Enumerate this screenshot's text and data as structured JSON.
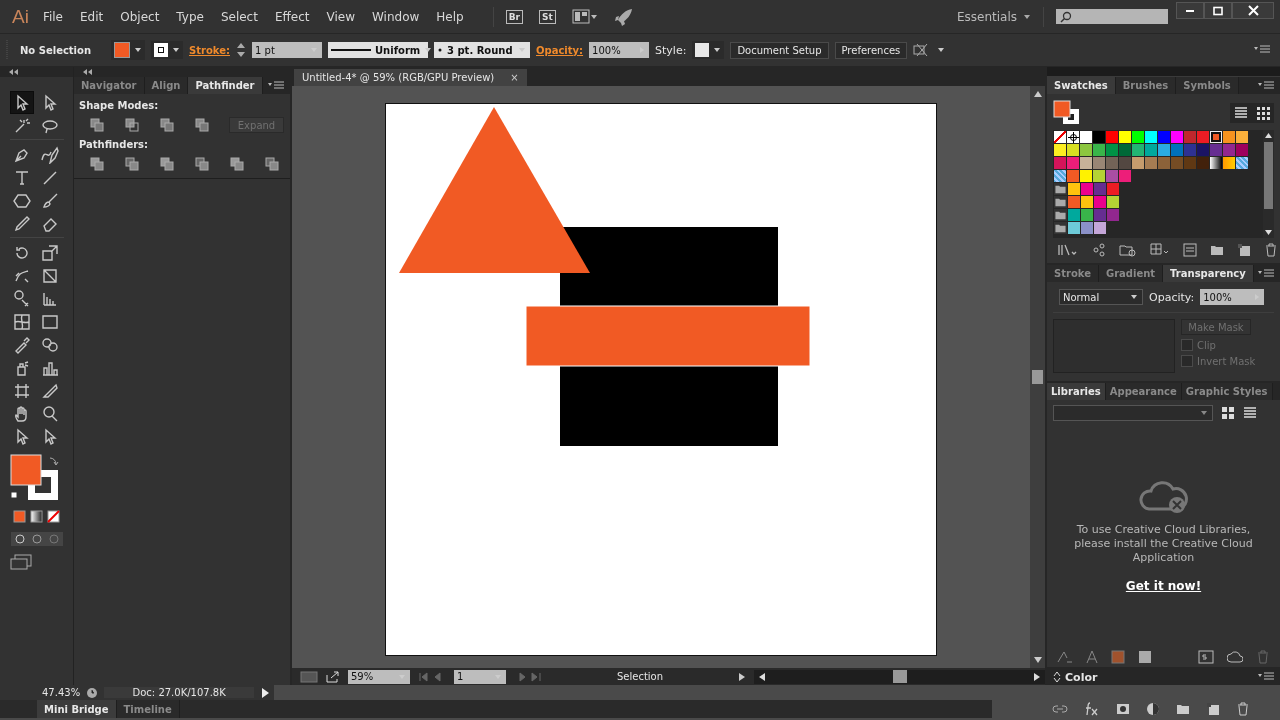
{
  "app": {
    "logo": "Ai",
    "menus": [
      "File",
      "Edit",
      "Object",
      "Type",
      "Select",
      "Effect",
      "View",
      "Window",
      "Help"
    ],
    "badges": [
      "Br",
      "St"
    ],
    "workspace": "Essentials"
  },
  "control_bar": {
    "selection": "No Selection",
    "stroke_label": "Stroke:",
    "stroke_weight": "1 pt",
    "profile": "Uniform",
    "brush": "3 pt. Round",
    "opacity_label": "Opacity:",
    "opacity": "100%",
    "style_label": "Style:",
    "buttons": [
      "Document Setup",
      "Preferences"
    ]
  },
  "tools": [
    {
      "selected": true
    },
    {
      "selected": false
    },
    {
      "selected": false
    },
    {
      "selected": false
    },
    {
      "selected": false
    },
    {
      "selected": false
    },
    {
      "selected": false
    },
    {
      "selected": false
    },
    {
      "selected": false
    },
    {
      "selected": false
    },
    {
      "selected": false
    },
    {
      "selected": false
    },
    {
      "selected": false
    },
    {
      "selected": false
    },
    {
      "selected": false
    },
    {
      "selected": false
    },
    {
      "selected": false
    },
    {
      "selected": false
    },
    {
      "selected": false
    },
    {
      "selected": false
    },
    {
      "selected": false
    },
    {
      "selected": false
    },
    {
      "selected": false
    },
    {
      "selected": false
    },
    {
      "selected": false
    },
    {
      "selected": false
    },
    {
      "selected": false
    },
    {
      "selected": false
    },
    {
      "selected": false
    },
    {
      "selected": false
    }
  ],
  "left_panel": {
    "tabs": [
      {
        "label": "Navigator",
        "selected": false
      },
      {
        "label": "Align",
        "selected": false
      },
      {
        "label": "Pathfinder",
        "selected": true
      }
    ],
    "shape_modes_label": "Shape Modes:",
    "expand": {
      "label": "Expand",
      "disabled": true
    },
    "pathfinders_label": "Pathfinders:"
  },
  "document": {
    "tab_title": "Untitled-4* @ 59% (RGB/GPU Preview)",
    "close": "×"
  },
  "status_bar": {
    "zoom": "59%",
    "page": "1",
    "tool": "Selection"
  },
  "swatches_panel": {
    "tabs": [
      {
        "label": "Swatches",
        "selected": true
      },
      {
        "label": "Brushes",
        "selected": false
      },
      {
        "label": "Symbols",
        "selected": false
      }
    ],
    "rows": [
      [
        {
          "kind": "none",
          "selected": false
        },
        {
          "kind": "registration",
          "selected": false
        },
        {
          "kind": "solid",
          "color": "#ffffff",
          "selected": false
        },
        {
          "kind": "solid",
          "color": "#000000",
          "selected": false
        },
        {
          "kind": "solid",
          "color": "#ff0000",
          "selected": false
        },
        {
          "kind": "solid",
          "color": "#ffff00",
          "selected": false
        },
        {
          "kind": "solid",
          "color": "#00ff00",
          "selected": false
        },
        {
          "kind": "solid",
          "color": "#00ffff",
          "selected": false
        },
        {
          "kind": "solid",
          "color": "#0000ff",
          "selected": false
        },
        {
          "kind": "solid",
          "color": "#ff00ff",
          "selected": false
        },
        {
          "kind": "solid",
          "color": "#c1272d",
          "selected": false
        },
        {
          "kind": "solid",
          "color": "#ed1c24",
          "selected": false
        },
        {
          "kind": "solid",
          "color": "#f15a24",
          "selected": true
        },
        {
          "kind": "solid",
          "color": "#f7931e",
          "selected": false
        },
        {
          "kind": "solid",
          "color": "#fbb03b",
          "selected": false
        }
      ],
      [
        {
          "kind": "solid",
          "color": "#fcee21",
          "selected": false
        },
        {
          "kind": "solid",
          "color": "#d9e021",
          "selected": false
        },
        {
          "kind": "solid",
          "color": "#8cc63f",
          "selected": false
        },
        {
          "kind": "solid",
          "color": "#39b54a",
          "selected": false
        },
        {
          "kind": "solid",
          "color": "#009245",
          "selected": false
        },
        {
          "kind": "solid",
          "color": "#006837",
          "selected": false
        },
        {
          "kind": "solid",
          "color": "#22b573",
          "selected": false
        },
        {
          "kind": "solid",
          "color": "#00a99d",
          "selected": false
        },
        {
          "kind": "solid",
          "color": "#29abe2",
          "selected": false
        },
        {
          "kind": "solid",
          "color": "#0071bc",
          "selected": false
        },
        {
          "kind": "solid",
          "color": "#2e3192",
          "selected": false
        },
        {
          "kind": "solid",
          "color": "#1b1464",
          "selected": false
        },
        {
          "kind": "solid",
          "color": "#662d91",
          "selected": false
        },
        {
          "kind": "solid",
          "color": "#93278f",
          "selected": false
        },
        {
          "kind": "solid",
          "color": "#9e005d",
          "selected": false
        }
      ],
      [
        {
          "kind": "solid",
          "color": "#d4145a",
          "selected": false
        },
        {
          "kind": "solid",
          "color": "#ed1e79",
          "selected": false
        },
        {
          "kind": "solid",
          "color": "#c7b299",
          "selected": false
        },
        {
          "kind": "solid",
          "color": "#998675",
          "selected": false
        },
        {
          "kind": "solid",
          "color": "#736357",
          "selected": false
        },
        {
          "kind": "solid",
          "color": "#534741",
          "selected": false
        },
        {
          "kind": "solid",
          "color": "#c69c6d",
          "selected": false
        },
        {
          "kind": "solid",
          "color": "#a67c52",
          "selected": false
        },
        {
          "kind": "solid",
          "color": "#8c6239",
          "selected": false
        },
        {
          "kind": "solid",
          "color": "#754c24",
          "selected": false
        },
        {
          "kind": "solid",
          "color": "#603813",
          "selected": false
        },
        {
          "kind": "solid",
          "color": "#42210b",
          "selected": false
        },
        {
          "kind": "gradient",
          "selected": false
        },
        {
          "kind": "gradient",
          "selected": false
        },
        {
          "kind": "pattern",
          "selected": false
        }
      ],
      [
        {
          "kind": "pattern",
          "selected": false
        },
        {
          "kind": "solid",
          "color": "#f15a24",
          "selected": false
        },
        {
          "kind": "solid",
          "color": "#fff200",
          "selected": false
        },
        {
          "kind": "solid",
          "color": "#b5d334",
          "selected": false
        },
        {
          "kind": "solid",
          "color": "#a94ea3",
          "selected": false
        },
        {
          "kind": "solid",
          "color": "#ed1e79",
          "selected": false
        }
      ]
    ],
    "groups": [
      [
        {
          "color": "#ffc20e",
          "selected": false
        },
        {
          "color": "#ec008c",
          "selected": false
        },
        {
          "color": "#662d91",
          "selected": false
        },
        {
          "color": "#ed1c24",
          "selected": false
        }
      ],
      [
        {
          "color": "#f15a24",
          "selected": false
        },
        {
          "color": "#ffc20e",
          "selected": false
        },
        {
          "color": "#ec008c",
          "selected": false
        },
        {
          "color": "#b5d334",
          "selected": false
        }
      ],
      [
        {
          "color": "#00a99d",
          "selected": false
        },
        {
          "color": "#39b54a",
          "selected": false
        },
        {
          "color": "#662d91",
          "selected": false
        },
        {
          "color": "#92278f",
          "selected": false
        }
      ],
      [
        {
          "color": "#6dcad8",
          "selected": false
        },
        {
          "color": "#8b91c8",
          "selected": false
        },
        {
          "color": "#c4a6d8",
          "selected": false
        }
      ]
    ]
  },
  "transparency_panel": {
    "tabs": [
      {
        "label": "Stroke",
        "selected": false
      },
      {
        "label": "Gradient",
        "selected": false
      },
      {
        "label": "Transparency",
        "selected": true
      }
    ],
    "blend_mode": "Normal",
    "opacity_label": "Opacity:",
    "opacity": "100%",
    "make_mask": {
      "label": "Make Mask",
      "disabled": true
    },
    "options": [
      {
        "label": "Clip",
        "checked": false,
        "disabled": true
      },
      {
        "label": "Invert Mask",
        "checked": false,
        "disabled": true
      }
    ]
  },
  "libraries_panel": {
    "tabs": [
      {
        "label": "Libraries",
        "selected": true
      },
      {
        "label": "Appearance",
        "selected": false
      },
      {
        "label": "Graphic Styles",
        "selected": false
      }
    ],
    "message": "To use Creative Cloud Libraries, please install the Creative Cloud Application",
    "link": "Get it now!"
  },
  "color_panel": {
    "title": "Color"
  },
  "bottom": {
    "zoom_readout": "47.43%",
    "doc_info": "Doc: 27.0K/107.8K",
    "tabs": [
      {
        "label": "Mini Bridge",
        "selected": true
      },
      {
        "label": "Timeline",
        "selected": false
      }
    ]
  }
}
